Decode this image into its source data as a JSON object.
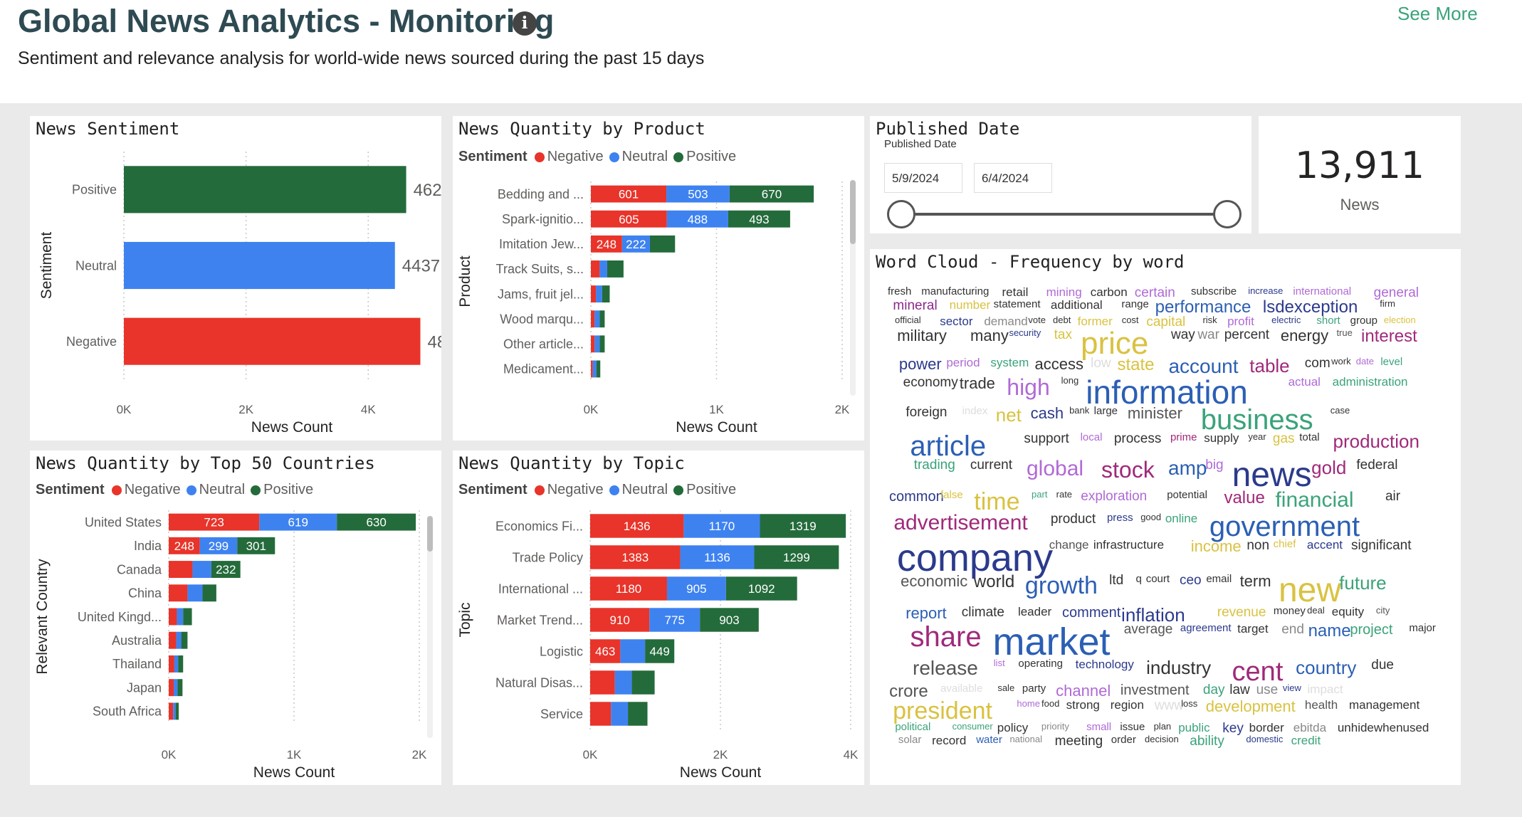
{
  "header": {
    "title": "Global News Analytics - Monitoring",
    "info_icon": "i",
    "see_more": "See More",
    "subtitle": "Sentiment and relevance analysis for world-wide news sourced during the past 15 days"
  },
  "colors": {
    "negative": "#e8342a",
    "neutral": "#3e82f0",
    "positive": "#246b3b"
  },
  "legend": {
    "title": "Sentiment",
    "negative": "Negative",
    "neutral": "Neutral",
    "positive": "Positive"
  },
  "panels": {
    "sentiment_title": "News Sentiment",
    "product_title": "News Quantity by Product",
    "countries_title": "News Quantity by Top 50 Countries",
    "topic_title": "News Quantity by Topic",
    "date_title": "Published Date",
    "wordcloud_title": "Word Cloud - Frequency by word"
  },
  "date_filter": {
    "label": "Published Date",
    "start": "5/9/2024",
    "end": "6/4/2024"
  },
  "kpi": {
    "value": "13,911",
    "label": "News"
  },
  "chart_data": [
    {
      "id": "sentiment",
      "type": "bar",
      "orientation": "horizontal",
      "title": "News Sentiment",
      "categories": [
        "Positive",
        "Neutral",
        "Negative"
      ],
      "values": [
        4621,
        4437,
        4853
      ],
      "colors": [
        "#246b3b",
        "#3e82f0",
        "#e8342a"
      ],
      "xlabel": "News Count",
      "ylabel": "Sentiment",
      "xlim": [
        0,
        5500
      ],
      "xticks": [
        0,
        2000,
        4000
      ],
      "xtick_labels": [
        "0K",
        "2K",
        "4K"
      ]
    },
    {
      "id": "product",
      "type": "bar",
      "stacked": true,
      "orientation": "horizontal",
      "title": "News Quantity by Product",
      "categories": [
        "Bedding and ...",
        "Spark-ignitio...",
        "Imitation Jew...",
        "Track Suits, s...",
        "Jams, fruit jel...",
        "Wood marqu...",
        "Other article...",
        "Medicament..."
      ],
      "series": [
        {
          "name": "Negative",
          "values": [
            601,
            605,
            248,
            70,
            40,
            30,
            30,
            15
          ],
          "labels": [
            "601",
            "605",
            "248",
            "",
            "",
            "",
            "",
            ""
          ]
        },
        {
          "name": "Neutral",
          "values": [
            503,
            488,
            222,
            60,
            50,
            40,
            40,
            30
          ],
          "labels": [
            "503",
            "488",
            "222",
            "",
            "",
            "",
            "",
            ""
          ]
        },
        {
          "name": "Positive",
          "values": [
            670,
            493,
            200,
            130,
            60,
            40,
            40,
            30
          ],
          "labels": [
            "670",
            "493",
            "",
            "",
            "",
            "",
            "",
            ""
          ]
        }
      ],
      "xlabel": "News Count",
      "ylabel": "Product",
      "xlim": [
        0,
        2000
      ],
      "xticks": [
        0,
        1000,
        2000
      ],
      "xtick_labels": [
        "0K",
        "1K",
        "2K"
      ]
    },
    {
      "id": "countries",
      "type": "bar",
      "stacked": true,
      "orientation": "horizontal",
      "title": "News Quantity by Top 50 Countries",
      "categories": [
        "United States",
        "India",
        "Canada",
        "China",
        "United Kingd...",
        "Australia",
        "Thailand",
        "Japan",
        "South Africa"
      ],
      "series": [
        {
          "name": "Negative",
          "values": [
            723,
            248,
            190,
            150,
            65,
            60,
            45,
            40,
            35
          ],
          "labels": [
            "723",
            "248",
            "",
            "",
            "",
            "",
            "",
            "",
            ""
          ]
        },
        {
          "name": "Neutral",
          "values": [
            619,
            299,
            150,
            120,
            50,
            40,
            30,
            30,
            20
          ],
          "labels": [
            "619",
            "299",
            "",
            "",
            "",
            "",
            "",
            "",
            ""
          ]
        },
        {
          "name": "Positive",
          "values": [
            630,
            301,
            232,
            110,
            70,
            50,
            40,
            40,
            25
          ],
          "labels": [
            "630",
            "301",
            "232",
            "",
            "",
            "",
            "",
            "",
            ""
          ]
        }
      ],
      "xlabel": "News Count",
      "ylabel": "Relevant Country",
      "xlim": [
        0,
        2000
      ],
      "xticks": [
        0,
        1000,
        2000
      ],
      "xtick_labels": [
        "0K",
        "1K",
        "2K"
      ]
    },
    {
      "id": "topic",
      "type": "bar",
      "stacked": true,
      "orientation": "horizontal",
      "title": "News Quantity by Topic",
      "categories": [
        "Economics Fi...",
        "Trade Policy",
        "International ...",
        "Market Trend...",
        "Logistic",
        "Natural Disas...",
        "Service"
      ],
      "series": [
        {
          "name": "Negative",
          "values": [
            1436,
            1383,
            1180,
            910,
            463,
            380,
            320
          ],
          "labels": [
            "1436",
            "1383",
            "1180",
            "910",
            "463",
            "",
            ""
          ]
        },
        {
          "name": "Neutral",
          "values": [
            1170,
            1136,
            905,
            775,
            380,
            260,
            260
          ],
          "labels": [
            "1170",
            "1136",
            "905",
            "775",
            "",
            "",
            ""
          ]
        },
        {
          "name": "Positive",
          "values": [
            1319,
            1299,
            1092,
            903,
            449,
            350,
            300
          ],
          "labels": [
            "1319",
            "1299",
            "1092",
            "903",
            "449",
            "",
            ""
          ]
        }
      ],
      "xlabel": "News Count",
      "ylabel": "Topic",
      "xlim": [
        0,
        4000
      ],
      "xticks": [
        0,
        2000,
        4000
      ],
      "xtick_labels": [
        "0K",
        "2K",
        "4K"
      ]
    }
  ],
  "wordcloud": {
    "words": [
      [
        "fresh",
        "#333"
      ],
      [
        "manufacturing",
        "#333"
      ],
      [
        "retail",
        "#333"
      ],
      [
        "mining",
        "#b06ad6"
      ],
      [
        "carbon",
        "#333"
      ],
      [
        "certain",
        "#b06ad6"
      ],
      [
        "subscribe",
        "#333"
      ],
      [
        "increase",
        "#2b3a8c"
      ],
      [
        "international",
        "#b06ad6"
      ],
      [
        "general",
        "#b06ad6"
      ],
      [
        "mineral",
        "#8a2b8a"
      ],
      [
        "number",
        "#d9c241"
      ],
      [
        "statement",
        "#333"
      ],
      [
        "additional",
        "#333"
      ],
      [
        "range",
        "#333"
      ],
      [
        "performance",
        "#2b5fb4"
      ],
      [
        "lsdexception",
        "#2b3a8c"
      ],
      [
        "firm",
        "#333"
      ],
      [
        "official",
        "#333"
      ],
      [
        "sector",
        "#2b3a8c"
      ],
      [
        "demand",
        "#888"
      ],
      [
        "vote",
        "#333"
      ],
      [
        "debt",
        "#333"
      ],
      [
        "former",
        "#d9c241"
      ],
      [
        "cost",
        "#333"
      ],
      [
        "capital",
        "#d9c241"
      ],
      [
        "risk",
        "#333"
      ],
      [
        "profit",
        "#b06ad6"
      ],
      [
        "electric",
        "#2b3a8c"
      ],
      [
        "short",
        "#3aa37a"
      ],
      [
        "group",
        "#333"
      ],
      [
        "election",
        "#d9c241"
      ],
      [
        "military",
        "#333"
      ],
      [
        "many",
        "#333"
      ],
      [
        "security",
        "#2b3a8c"
      ],
      [
        "tax",
        "#d9c241"
      ],
      [
        "price",
        "#d9c241"
      ],
      [
        "way",
        "#333"
      ],
      [
        "war",
        "#888"
      ],
      [
        "percent",
        "#333"
      ],
      [
        "energy",
        "#333"
      ],
      [
        "true",
        "#555"
      ],
      [
        "interest",
        "#a0297a"
      ],
      [
        "power",
        "#2b3a8c"
      ],
      [
        "period",
        "#b06ad6"
      ],
      [
        "system",
        "#3aa37a"
      ],
      [
        "access",
        "#333"
      ],
      [
        "low",
        "#ddd"
      ],
      [
        "state",
        "#d9c241"
      ],
      [
        "account",
        "#2b5fb4"
      ],
      [
        "table",
        "#a0297a"
      ],
      [
        "com",
        "#333"
      ],
      [
        "work",
        "#333"
      ],
      [
        "date",
        "#b06ad6"
      ],
      [
        "level",
        "#3aa37a"
      ],
      [
        "economy",
        "#333"
      ],
      [
        "trade",
        "#333"
      ],
      [
        "high",
        "#b06ad6"
      ],
      [
        "long",
        "#333"
      ],
      [
        "information",
        "#2b5fb4"
      ],
      [
        "actual",
        "#b06ad6"
      ],
      [
        "administration",
        "#3aa37a"
      ],
      [
        "foreign",
        "#333"
      ],
      [
        "index",
        "#ddd"
      ],
      [
        "net",
        "#d9c241"
      ],
      [
        "cash",
        "#2b3a8c"
      ],
      [
        "bank",
        "#333"
      ],
      [
        "large",
        "#333"
      ],
      [
        "minister",
        "#555"
      ],
      [
        "business",
        "#3aa37a"
      ],
      [
        "case",
        "#333"
      ],
      [
        "article",
        "#2b5fb4"
      ],
      [
        "support",
        "#333"
      ],
      [
        "local",
        "#b06ad6"
      ],
      [
        "process",
        "#333"
      ],
      [
        "prime",
        "#a0297a"
      ],
      [
        "supply",
        "#333"
      ],
      [
        "year",
        "#333"
      ],
      [
        "gas",
        "#d9c241"
      ],
      [
        "total",
        "#333"
      ],
      [
        "production",
        "#a0297a"
      ],
      [
        "trading",
        "#3aa37a"
      ],
      [
        "current",
        "#333"
      ],
      [
        "global",
        "#b06ad6"
      ],
      [
        "stock",
        "#a0297a"
      ],
      [
        "amp",
        "#2b5fb4"
      ],
      [
        "big",
        "#b06ad6"
      ],
      [
        "news",
        "#2b3a8c"
      ],
      [
        "gold",
        "#a0297a"
      ],
      [
        "federal",
        "#333"
      ],
      [
        "common",
        "#2b3a8c"
      ],
      [
        "false",
        "#d9c241"
      ],
      [
        "time",
        "#d9c241"
      ],
      [
        "part",
        "#3aa37a"
      ],
      [
        "rate",
        "#333"
      ],
      [
        "exploration",
        "#b06ad6"
      ],
      [
        "potential",
        "#333"
      ],
      [
        "value",
        "#a0297a"
      ],
      [
        "financial",
        "#3aa37a"
      ],
      [
        "air",
        "#333"
      ],
      [
        "advertisement",
        "#a0297a"
      ],
      [
        "product",
        "#333"
      ],
      [
        "press",
        "#2b3a8c"
      ],
      [
        "good",
        "#333"
      ],
      [
        "online",
        "#3aa37a"
      ],
      [
        "government",
        "#2b5fb4"
      ],
      [
        "company",
        "#2b3a8c"
      ],
      [
        "change",
        "#555"
      ],
      [
        "infrastructure",
        "#333"
      ],
      [
        "income",
        "#d9c241"
      ],
      [
        "non",
        "#333"
      ],
      [
        "chief",
        "#d9c241"
      ],
      [
        "accent",
        "#2b3a8c"
      ],
      [
        "significant",
        "#333"
      ],
      [
        "economic",
        "#555"
      ],
      [
        "world",
        "#333"
      ],
      [
        "growth",
        "#2b5fb4"
      ],
      [
        "ltd",
        "#333"
      ],
      [
        "q",
        "#333"
      ],
      [
        "court",
        "#333"
      ],
      [
        "ceo",
        "#2b3a8c"
      ],
      [
        "email",
        "#333"
      ],
      [
        "term",
        "#333"
      ],
      [
        "new",
        "#d9c241"
      ],
      [
        "future",
        "#3aa37a"
      ],
      [
        "report",
        "#2b5fb4"
      ],
      [
        "climate",
        "#333"
      ],
      [
        "leader",
        "#333"
      ],
      [
        "comment",
        "#2b3a8c"
      ],
      [
        "inflation",
        "#2b3a8c"
      ],
      [
        "revenue",
        "#d9c241"
      ],
      [
        "money",
        "#333"
      ],
      [
        "deal",
        "#333"
      ],
      [
        "equity",
        "#333"
      ],
      [
        "city",
        "#555"
      ],
      [
        "share",
        "#a0297a"
      ],
      [
        "market",
        "#2b5fb4"
      ],
      [
        "average",
        "#555"
      ],
      [
        "agreement",
        "#2b3a8c"
      ],
      [
        "target",
        "#333"
      ],
      [
        "end",
        "#888"
      ],
      [
        "name",
        "#2b5fb4"
      ],
      [
        "project",
        "#3aa37a"
      ],
      [
        "major",
        "#333"
      ],
      [
        "release",
        "#555"
      ],
      [
        "list",
        "#b06ad6"
      ],
      [
        "operating",
        "#333"
      ],
      [
        "technology",
        "#2b3a8c"
      ],
      [
        "industry",
        "#333"
      ],
      [
        "cent",
        "#a0297a"
      ],
      [
        "country",
        "#2b5fb4"
      ],
      [
        "due",
        "#333"
      ],
      [
        "crore",
        "#555"
      ],
      [
        "available",
        "#ddd"
      ],
      [
        "sale",
        "#333"
      ],
      [
        "party",
        "#333"
      ],
      [
        "channel",
        "#b06ad6"
      ],
      [
        "investment",
        "#555"
      ],
      [
        "day",
        "#3aa37a"
      ],
      [
        "law",
        "#333"
      ],
      [
        "use",
        "#888"
      ],
      [
        "view",
        "#2b3a8c"
      ],
      [
        "impact",
        "#ddd"
      ],
      [
        "president",
        "#d9c241"
      ],
      [
        "home",
        "#b06ad6"
      ],
      [
        "food",
        "#333"
      ],
      [
        "strong",
        "#333"
      ],
      [
        "region",
        "#333"
      ],
      [
        "www",
        "#ddd"
      ],
      [
        "loss",
        "#333"
      ],
      [
        "development",
        "#d9c241"
      ],
      [
        "health",
        "#555"
      ],
      [
        "management",
        "#333"
      ],
      [
        "political",
        "#3aa37a"
      ],
      [
        "consumer",
        "#3aa37a"
      ],
      [
        "policy",
        "#333"
      ],
      [
        "priority",
        "#888"
      ],
      [
        "small",
        "#b06ad6"
      ],
      [
        "issue",
        "#333"
      ],
      [
        "plan",
        "#333"
      ],
      [
        "public",
        "#3aa37a"
      ],
      [
        "key",
        "#2b3a8c"
      ],
      [
        "border",
        "#333"
      ],
      [
        "ebitda",
        "#888"
      ],
      [
        "unhidewhenused",
        "#333"
      ],
      [
        "solar",
        "#888"
      ],
      [
        "record",
        "#333"
      ],
      [
        "water",
        "#2b5fb4"
      ],
      [
        "national",
        "#888"
      ],
      [
        "meeting",
        "#333"
      ],
      [
        "order",
        "#333"
      ],
      [
        "decision",
        "#333"
      ],
      [
        "ability",
        "#3aa37a"
      ],
      [
        "domestic",
        "#2b3a8c"
      ],
      [
        "credit",
        "#3aa37a"
      ]
    ]
  }
}
